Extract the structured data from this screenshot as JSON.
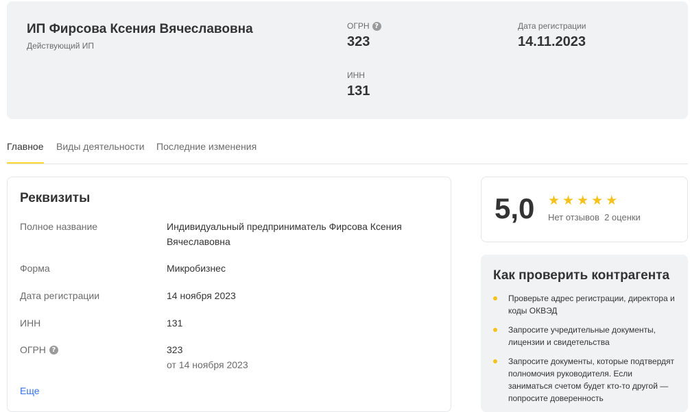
{
  "header": {
    "company_name": "ИП Фирсова Ксения Вячеславовна",
    "status": "Действующий ИП",
    "ogrn_label": "ОГРН",
    "ogrn_value": "323",
    "inn_label": "ИНН",
    "inn_value": "131",
    "reg_date_label": "Дата регистрации",
    "reg_date_value": "14.11.2023"
  },
  "tabs": [
    {
      "label": "Главное",
      "active": true
    },
    {
      "label": "Виды деятельности",
      "active": false
    },
    {
      "label": "Последние изменения",
      "active": false
    }
  ],
  "requisites": {
    "title": "Реквизиты",
    "full_name_label": "Полное название",
    "full_name_value": "Индивидуальный предприниматель Фирсова Ксения Вячеславовна",
    "form_label": "Форма",
    "form_value": "Микробизнес",
    "reg_date_label": "Дата регистрации",
    "reg_date_value": "14 ноября 2023",
    "inn_label": "ИНН",
    "inn_value": "131",
    "ogrn_label": "ОГРН",
    "ogrn_value": "323",
    "ogrn_date": "от 14 ноября 2023",
    "more_link": "Еще"
  },
  "rating": {
    "score": "5,0",
    "stars": 5,
    "reviews": "Нет отзывов",
    "ratings_count": "2 оценки"
  },
  "check": {
    "title": "Как проверить контрагента",
    "items": [
      "Проверьте адрес регистрации, директора и коды ОКВЭД",
      "Запросите учредительные документы, лицензии и свидетельства",
      "Запросите документы, которые подтвердят полномочия руководителя. Если заниматься счетом будет кто-то другой — попросите доверенность"
    ]
  },
  "colors": {
    "accent_yellow": "#fdd835",
    "star_yellow": "#f5c21b",
    "link_blue": "#336fee",
    "card_gray": "#f1f2f4"
  },
  "icons": {
    "help": "question-circle-icon",
    "star": "star-icon"
  }
}
